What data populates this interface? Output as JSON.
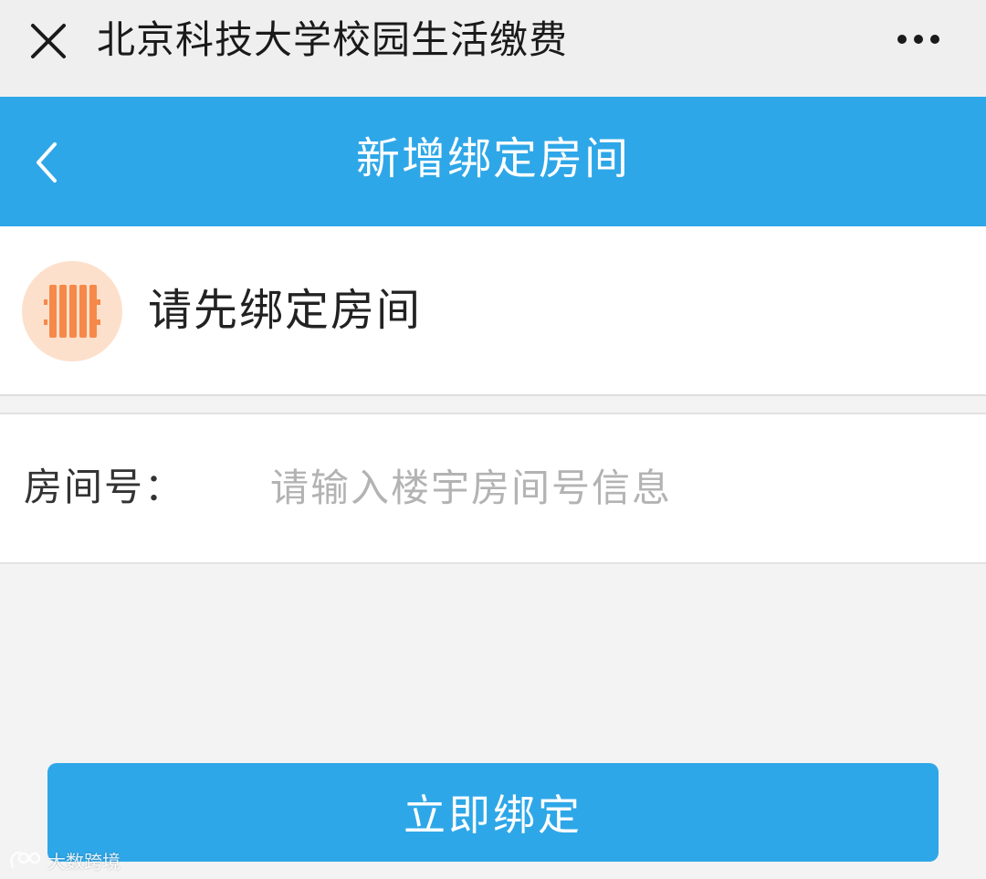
{
  "wechat_bar": {
    "title": "北京科技大学校园生活缴费",
    "close_icon": "close-icon",
    "more_icon": "more-icon"
  },
  "header": {
    "title": "新增绑定房间",
    "back_icon": "chevron-left-icon",
    "background": "#2ea7e8"
  },
  "notice": {
    "icon": "radiator-icon",
    "text": "请先绑定房间"
  },
  "form": {
    "room_label": "房间号：",
    "room_value": "",
    "room_placeholder": "请输入楼宇房间号信息"
  },
  "actions": {
    "bind_label": "立即绑定"
  },
  "watermark": {
    "text": "大数跨境"
  },
  "colors": {
    "accent": "#2ea7e8",
    "icon_bg": "#fde0cb",
    "icon_fg": "#f5894a"
  }
}
